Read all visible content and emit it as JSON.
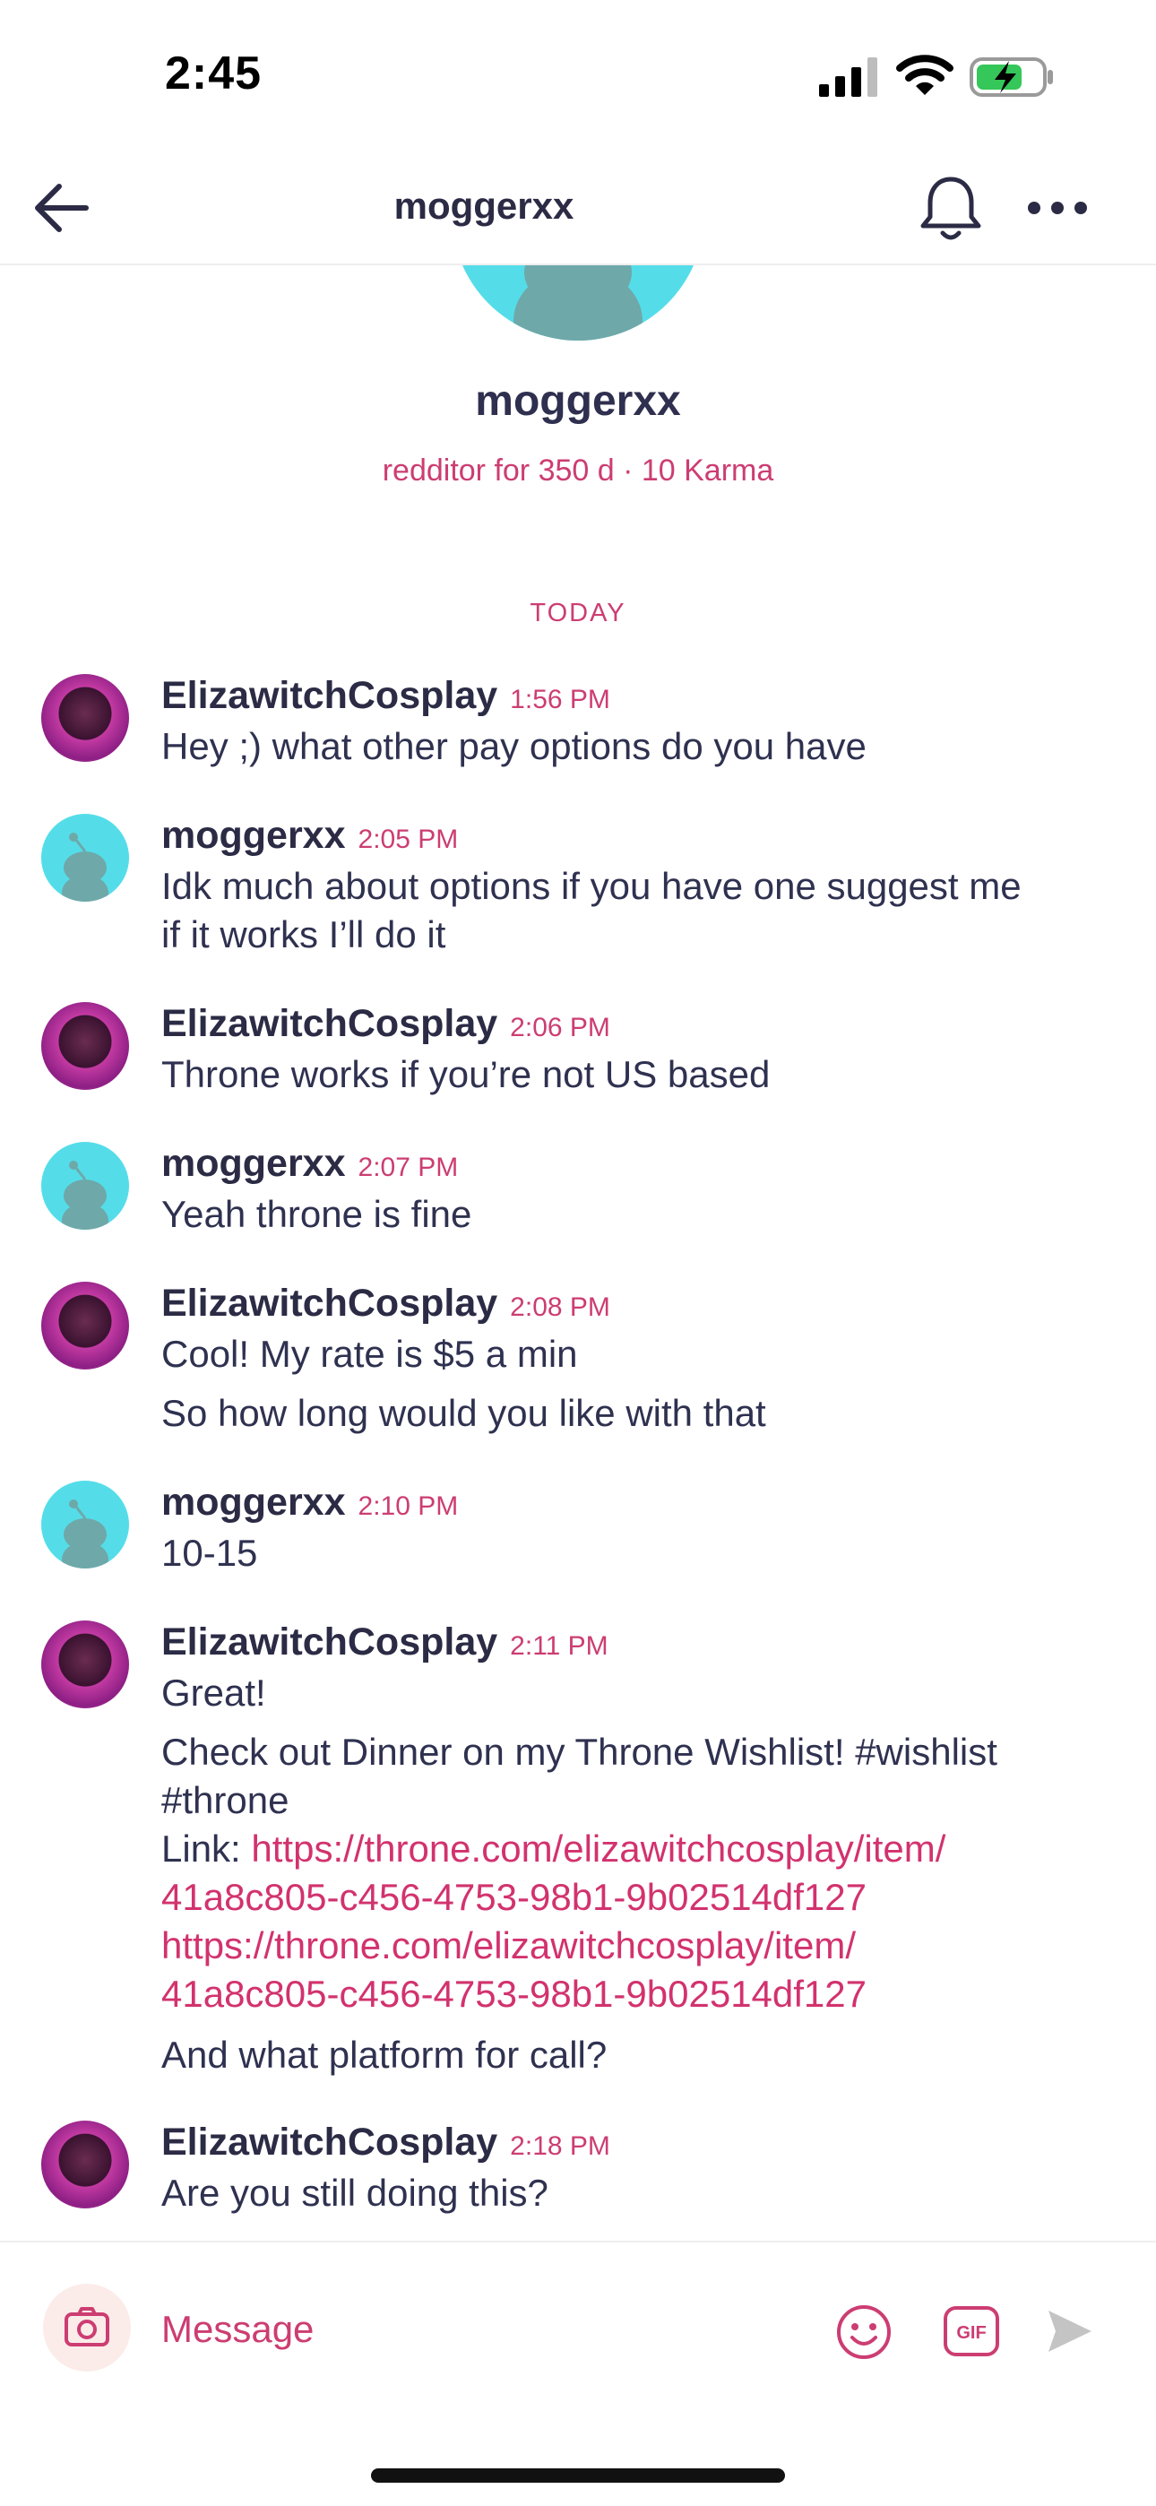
{
  "status_bar": {
    "time": "2:45"
  },
  "header": {
    "title": "moggerxx"
  },
  "profile": {
    "name": "moggerxx",
    "meta": "redditor for 350 d · 10 Karma"
  },
  "day_divider": "TODAY",
  "messages": [
    {
      "author": "ElizawitchCosplay",
      "time": "1:56 PM",
      "lines": [
        "Hey ;) what other pay options do you have"
      ]
    },
    {
      "author": "moggerxx",
      "time": "2:05 PM",
      "lines": [
        "Idk much about options if you have one suggest me",
        "if it works I’ll do it"
      ]
    },
    {
      "author": "ElizawitchCosplay",
      "time": "2:06 PM",
      "lines": [
        "Throne works if you’re not US based"
      ]
    },
    {
      "author": "moggerxx",
      "time": "2:07 PM",
      "lines": [
        "Yeah throne is fine"
      ]
    },
    {
      "author": "ElizawitchCosplay",
      "time": "2:08 PM",
      "lines": [
        "Cool! My rate is $5 a min",
        "So how long would you like with that"
      ]
    },
    {
      "author": "moggerxx",
      "time": "2:10 PM",
      "lines": [
        "10-15"
      ]
    },
    {
      "author": "ElizawitchCosplay",
      "time": "2:11 PM",
      "lines": [
        "Great!",
        "Check out Dinner  on my Throne Wishlist! #wishlist",
        "#throne"
      ],
      "link_prefix": " Link: ",
      "link_lines": [
        "https://throne.com/elizawitchcosplay/item/",
        "41a8c805-c456-4753-98b1-9b02514df127",
        "https://throne.com/elizawitchcosplay/item/",
        "41a8c805-c456-4753-98b1-9b02514df127"
      ],
      "after": "And what platform for call?"
    },
    {
      "author": "ElizawitchCosplay",
      "time": "2:18 PM",
      "lines": [
        "Are you still doing this?"
      ]
    }
  ],
  "composer": {
    "placeholder": "Message"
  },
  "colors": {
    "accent": "#cc3d72",
    "link": "#d2326e",
    "snoo_bg": "#54dde9",
    "text": "#2b2b45"
  },
  "icons": [
    "back-arrow-icon",
    "bell-icon",
    "more-icon",
    "camera-icon",
    "emoji-icon",
    "gif-icon",
    "send-icon"
  ]
}
